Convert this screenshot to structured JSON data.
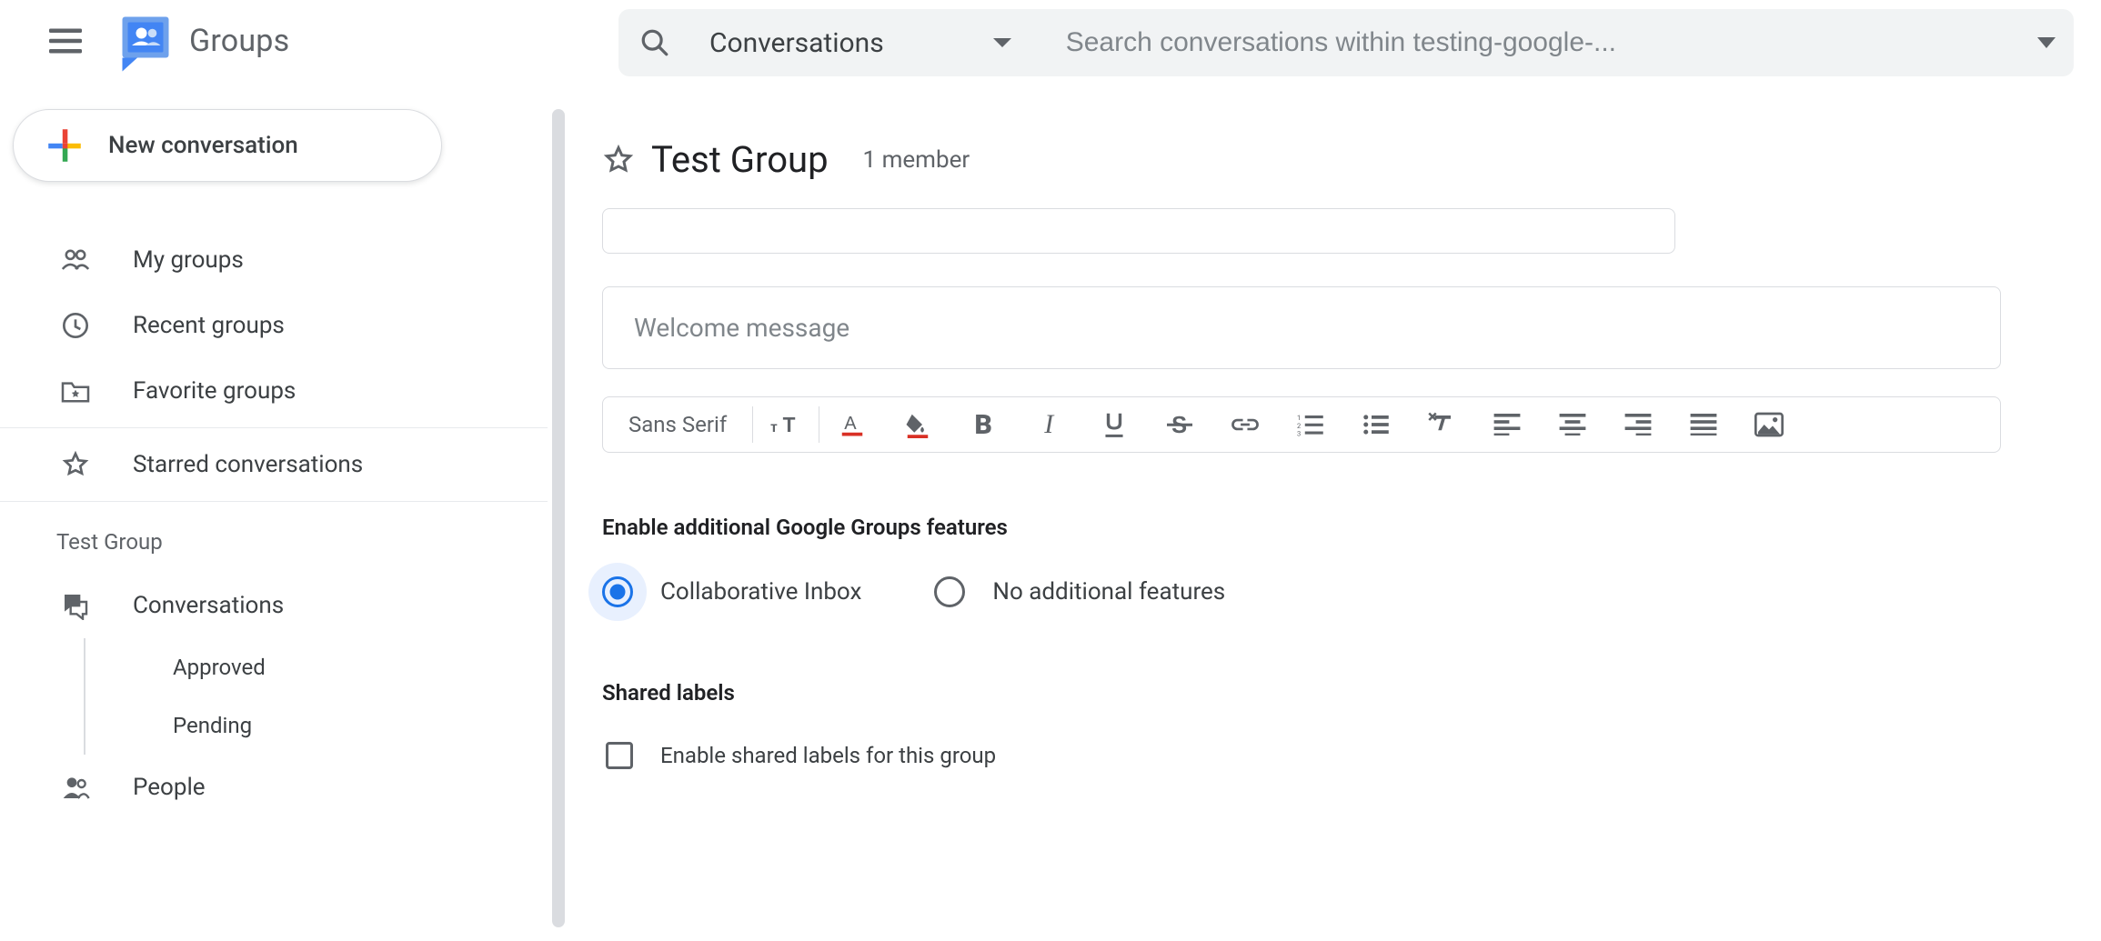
{
  "header": {
    "product_name": "Groups"
  },
  "search": {
    "scope_label": "Conversations",
    "placeholder": "Search conversations within testing-google-..."
  },
  "sidebar": {
    "new_conversation_label": "New conversation",
    "items": {
      "my_groups": "My groups",
      "recent_groups": "Recent groups",
      "favorite_groups": "Favorite groups",
      "starred_conversations": "Starred conversations"
    },
    "group_section_title": "Test Group",
    "group_items": {
      "conversations": "Conversations",
      "approved": "Approved",
      "pending": "Pending",
      "people": "People"
    }
  },
  "content": {
    "group_title": "Test Group",
    "member_count": "1 member",
    "welcome_placeholder": "Welcome message",
    "toolbar_font": "Sans Serif",
    "features_title": "Enable additional Google Groups features",
    "radio_collab": "Collaborative Inbox",
    "radio_none": "No additional features",
    "shared_labels_title": "Shared labels",
    "shared_labels_checkbox": "Enable shared labels for this group"
  }
}
